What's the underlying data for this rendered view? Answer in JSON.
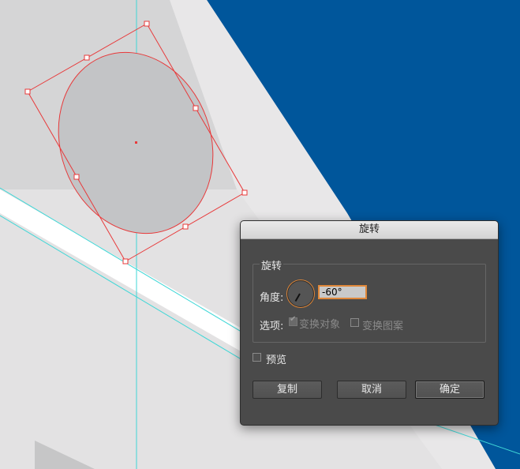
{
  "dialog": {
    "title": "旋转",
    "group_label": "旋转",
    "angle_label": "角度:",
    "angle_value": "-60°",
    "options_label": "选项:",
    "option_transform_objects": "变换对象",
    "option_transform_patterns": "变换图案",
    "preview_label": "预览",
    "copy_button": "复制",
    "cancel_button": "取消",
    "ok_button": "确定"
  },
  "state": {
    "transform_objects_checked": true,
    "transform_patterns_checked": false,
    "preview_checked": false,
    "dial_icon": "angle-dial-icon"
  },
  "colors": {
    "background_blue": "#00569b",
    "guide_cyan": "#3fd7d7",
    "selection_red": "#e8393a",
    "shape_gray": "#c3c4c6",
    "focus_orange": "#e0883a"
  }
}
